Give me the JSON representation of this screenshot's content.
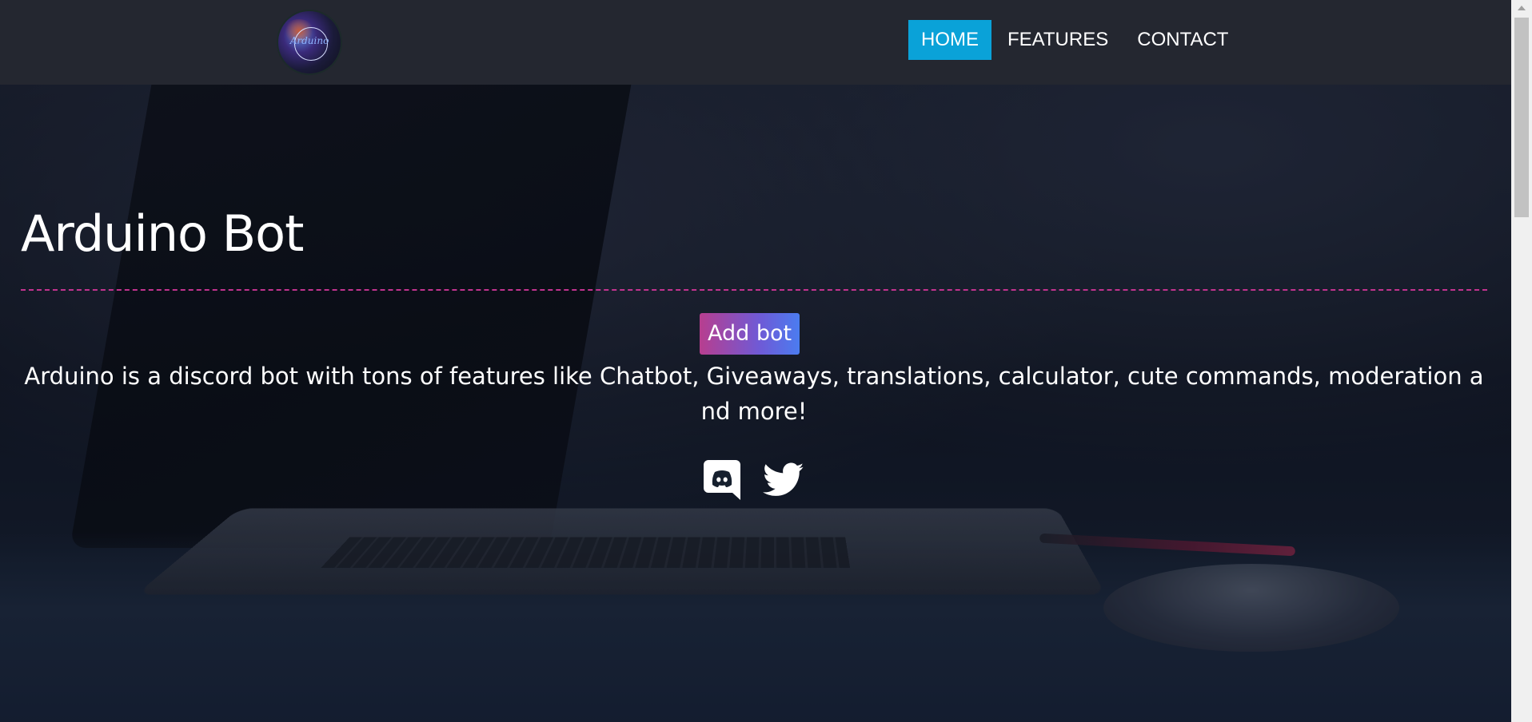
{
  "navbar": {
    "logo_text": "Arduino",
    "links": [
      {
        "label": "HOME",
        "active": true
      },
      {
        "label": "FEATURES",
        "active": false
      },
      {
        "label": "CONTACT",
        "active": false
      }
    ],
    "active_color": "#0aa2d8",
    "background": "#242730"
  },
  "hero": {
    "title": "Arduino Bot",
    "divider_color": "#c2338f",
    "add_bot_label": "Add bot",
    "description": "Arduino is a discord bot with tons of features like Chatbot, Giveaways, translations, calculator, cute commands, moderation and more!",
    "social": [
      {
        "name": "discord",
        "icon": "discord-icon"
      },
      {
        "name": "twitter",
        "icon": "twitter-icon"
      }
    ]
  }
}
